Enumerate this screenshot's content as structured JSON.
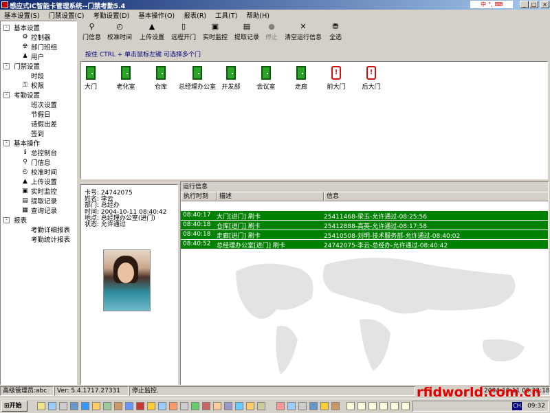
{
  "window": {
    "title": "感应式IC智能卡管理系统--门禁考勤5.4"
  },
  "menu": [
    "基本设置(S)",
    "门禁设置(C)",
    "考勤设置(D)",
    "基本操作(O)",
    "报表(R)",
    "工具(T)",
    "帮助(H)"
  ],
  "tree": [
    {
      "label": "基本设置",
      "level": 0,
      "expander": "-"
    },
    {
      "label": "控制器",
      "level": 1,
      "icon": "controller-icon"
    },
    {
      "label": "部门班组",
      "level": 1,
      "icon": "department-icon"
    },
    {
      "label": "用户",
      "level": 1,
      "icon": "user-icon"
    },
    {
      "label": "门禁设置",
      "level": 0,
      "expander": "-"
    },
    {
      "label": "时段",
      "level": 1
    },
    {
      "label": "权限",
      "level": 1,
      "icon": "key-icon"
    },
    {
      "label": "考勤设置",
      "level": 0,
      "expander": "-"
    },
    {
      "label": "班次设置",
      "level": 1
    },
    {
      "label": "节假日",
      "level": 1
    },
    {
      "label": "请假出差",
      "level": 1
    },
    {
      "label": "签到",
      "level": 1
    },
    {
      "label": "基本操作",
      "level": 0,
      "expander": "-"
    },
    {
      "label": "总控制台",
      "level": 1,
      "icon": "info-icon"
    },
    {
      "label": "门信息",
      "level": 1,
      "icon": "search-icon"
    },
    {
      "label": "校准时间",
      "level": 1,
      "icon": "clock-icon"
    },
    {
      "label": "上传设置",
      "level": 1,
      "icon": "upload-icon"
    },
    {
      "label": "实时监控",
      "level": 1,
      "icon": "monitor-icon"
    },
    {
      "label": "提取记录",
      "level": 1,
      "icon": "download-icon"
    },
    {
      "label": "查询记录",
      "level": 1,
      "icon": "query-icon"
    },
    {
      "label": "报表",
      "level": 0,
      "expander": "-"
    },
    {
      "label": "考勤详细报表",
      "level": 1
    },
    {
      "label": "考勤统计报表",
      "level": 1
    }
  ],
  "toolbar": [
    {
      "label": "门信息",
      "icon": "search-icon",
      "enabled": true
    },
    {
      "label": "校准时间",
      "icon": "clock-icon",
      "enabled": true
    },
    {
      "label": "上传设置",
      "icon": "upload-icon",
      "enabled": true
    },
    {
      "label": "远程开门",
      "icon": "door-icon",
      "enabled": true
    },
    {
      "label": "实时监控",
      "icon": "monitor-icon",
      "enabled": true
    },
    {
      "label": "提取记录",
      "icon": "download-icon",
      "enabled": true
    },
    {
      "label": "停止",
      "icon": "stop-icon",
      "enabled": false
    },
    {
      "label": "清空运行信息",
      "icon": "clear-icon",
      "enabled": true
    },
    {
      "label": "全选",
      "icon": "select-all-icon",
      "enabled": true
    }
  ],
  "hint": "按住 CTRL + 单击鼠标左键 可选择多个门",
  "doors": [
    {
      "name": "大门",
      "state": "closed"
    },
    {
      "name": "老化室",
      "state": "closed"
    },
    {
      "name": "仓库",
      "state": "closed"
    },
    {
      "name": "总经理办公室",
      "state": "closed"
    },
    {
      "name": "开发部",
      "state": "closed"
    },
    {
      "name": "会议室",
      "state": "closed"
    },
    {
      "name": "走廊",
      "state": "closed"
    },
    {
      "name": "前大门",
      "state": "alarm"
    },
    {
      "name": "后大门",
      "state": "alarm"
    }
  ],
  "card": {
    "card_no_label": "卡号:",
    "card_no": "24742075",
    "name_label": "姓名:",
    "name": "李云",
    "dept_label": "部门:",
    "dept": "总经办",
    "time_label": "时间:",
    "time": "2004-10-11 08:40:42",
    "place_label": "地点:",
    "place": "总经理办公室(进门)",
    "status_label": "状态:",
    "status": "允许通过"
  },
  "log": {
    "title": "运行信息",
    "columns": [
      "执行时刻",
      "描述",
      "信息"
    ],
    "rows": [
      {
        "time": "08:40:17",
        "desc": "大门[进门] 刷卡",
        "info": "25411468-梁玉-允许通过-08:25:56"
      },
      {
        "time": "08:40:18",
        "desc": "仓库[进门] 刷卡",
        "info": "25412888-高英-允许通过-08:17:58"
      },
      {
        "time": "08:40:18",
        "desc": "走廊[进门] 刷卡",
        "info": "25410508-刘明-技术服务部-允许通过-08:40:02"
      },
      {
        "time": "08:40:52",
        "desc": "总经理办公室[进门] 刷卡",
        "info": "24742075-李云-总经办-允许通过-08:40:42"
      }
    ]
  },
  "status": {
    "user": "高级管理员:abc",
    "version": "Ver: 5.4.1717.27331",
    "state": "停止监控.",
    "datetime": "2004-10-11 09:32:18"
  },
  "taskbar": {
    "start": "开始",
    "clock": "09:32",
    "ime": "CH"
  },
  "watermark": "rfidworld.com.cn",
  "colors": {
    "title_bar": "#0a246a",
    "log_row": "#008000",
    "door_closed": "#2aa52a",
    "door_alarm": "#d01010"
  }
}
